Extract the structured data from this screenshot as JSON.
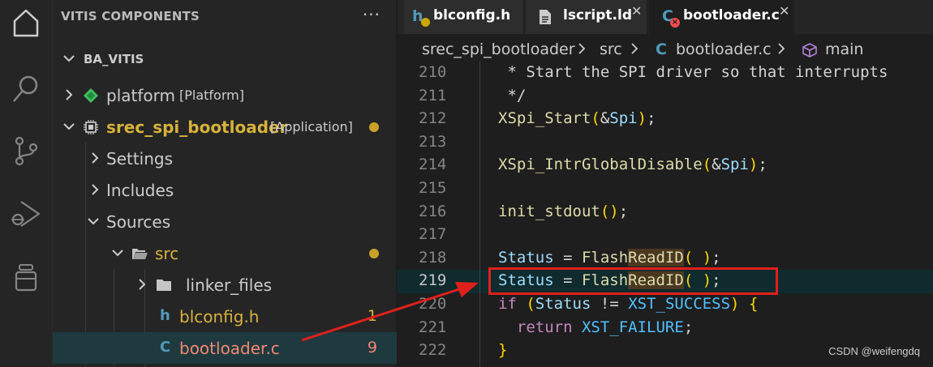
{
  "activity_bar": {
    "icons": [
      "explorer-icon",
      "search-icon",
      "source-control-icon",
      "run-debug-icon",
      "extensions-icon"
    ]
  },
  "sidebar": {
    "title": "VITIS COMPONENTS",
    "more": "···",
    "section": "BA_VITIS",
    "items": [
      {
        "label": "platform",
        "tag": "[Platform]"
      },
      {
        "label": "srec_spi_bootloader",
        "tag": "[Application]"
      },
      {
        "label": "Settings"
      },
      {
        "label": "Includes"
      },
      {
        "label": "Sources"
      },
      {
        "label": "src"
      },
      {
        "label": "linker_files"
      },
      {
        "label": "blconfig.h",
        "count": "1",
        "icon_letter": "h"
      },
      {
        "label": "bootloader.c",
        "count": "9",
        "icon_letter": "C"
      }
    ]
  },
  "tabs": [
    {
      "label": "blconfig.h",
      "icon_letter": "h",
      "close": "✕"
    },
    {
      "label": "lscript.ld",
      "close": "✕"
    },
    {
      "label": "bootloader.c",
      "icon_letter": "C",
      "close": "✕"
    }
  ],
  "breadcrumb": [
    "srec_spi_bootloader",
    "src",
    "bootloader.c",
    "main"
  ],
  "breadcrumb_c_letter": "C",
  "code": {
    "line_numbers": [
      "210",
      "211",
      "212",
      "213",
      "214",
      "215",
      "216",
      "217",
      "218",
      "219",
      "220",
      "221",
      "222"
    ],
    "current_line": "219",
    "lines": [
      " * Start the SPI driver so that interrupts",
      " */",
      "XSpi_Start(&Spi);",
      "",
      "XSpi_IntrGlobalDisable(&Spi);",
      "",
      "init_stdout();",
      "",
      "Status = FlashReadID( );",
      "Status = FlashReadID( );",
      "if (Status != XST_SUCCESS) {",
      "  return XST_FAILURE;",
      "}"
    ]
  },
  "watermark": "CSDN @weifengdq",
  "colors": {
    "accent_dot": "#c9a227",
    "error_red": "#f48771",
    "annotation_red": "#e0201c"
  }
}
